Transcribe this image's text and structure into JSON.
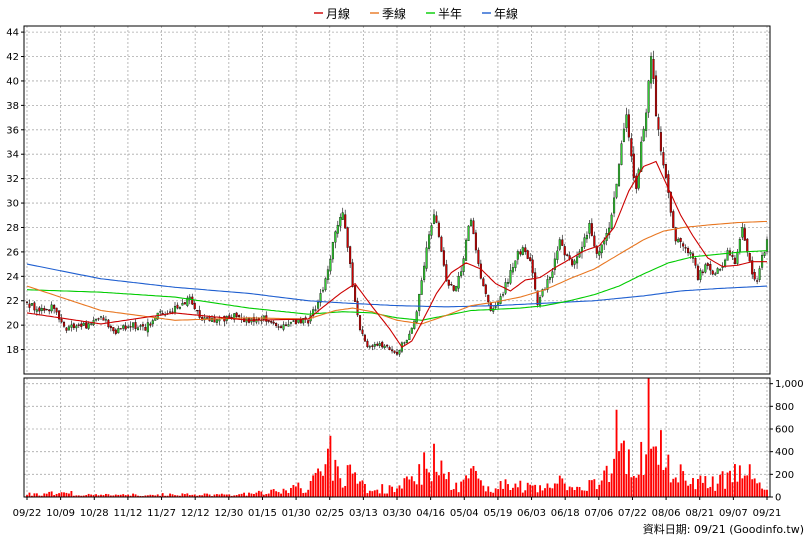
{
  "chart_data": [
    {
      "type": "candlestick",
      "legend": {
        "placement": "top-center",
        "items": [
          {
            "name": "月線",
            "color": "#cc0000"
          },
          {
            "name": "季線",
            "color": "#e87722"
          },
          {
            "name": "半年",
            "color": "#00cc00"
          },
          {
            "name": "年線",
            "color": "#1f5fd0"
          }
        ]
      },
      "ylim": [
        16,
        44.5
      ],
      "y_ticks": [
        18,
        20,
        22,
        24,
        26,
        28,
        30,
        32,
        34,
        36,
        38,
        40,
        42,
        44
      ],
      "x_tick_labels": [
        "09/22",
        "10/09",
        "10/28",
        "11/12",
        "11/27",
        "12/12",
        "12/30",
        "01/15",
        "01/30",
        "02/25",
        "03/13",
        "03/30",
        "04/16",
        "05/04",
        "05/19",
        "06/03",
        "06/18",
        "07/06",
        "07/22",
        "08/06",
        "08/21",
        "09/07",
        "09/21"
      ],
      "grid": true,
      "up_color": "#33cc33",
      "down_color": "#cc0000",
      "close_anchors": [
        [
          0,
          21.8
        ],
        [
          6,
          21.2
        ],
        [
          10,
          21.5
        ],
        [
          16,
          19.8
        ],
        [
          24,
          20.0
        ],
        [
          30,
          20.6
        ],
        [
          36,
          19.5
        ],
        [
          42,
          20.0
        ],
        [
          48,
          19.8
        ],
        [
          54,
          21.0
        ],
        [
          60,
          21.3
        ],
        [
          66,
          22.2
        ],
        [
          70,
          20.5
        ],
        [
          78,
          20.4
        ],
        [
          84,
          20.8
        ],
        [
          90,
          20.4
        ],
        [
          96,
          20.7
        ],
        [
          102,
          19.6
        ],
        [
          108,
          20.3
        ],
        [
          114,
          20.4
        ],
        [
          118,
          21.8
        ],
        [
          122,
          24.5
        ],
        [
          125,
          27.5
        ],
        [
          128,
          29.0
        ],
        [
          131,
          25.0
        ],
        [
          133,
          21.8
        ],
        [
          135,
          19.5
        ],
        [
          138,
          18.4
        ],
        [
          142,
          18.5
        ],
        [
          146,
          18.2
        ],
        [
          150,
          17.7
        ],
        [
          154,
          19.0
        ],
        [
          158,
          21.0
        ],
        [
          160,
          23.8
        ],
        [
          163,
          27.5
        ],
        [
          165,
          29.2
        ],
        [
          167,
          27.2
        ],
        [
          170,
          23.8
        ],
        [
          173,
          23.0
        ],
        [
          176,
          24.2
        ],
        [
          178,
          27.3
        ],
        [
          180,
          28.7
        ],
        [
          182,
          26.3
        ],
        [
          184,
          24.0
        ],
        [
          188,
          21.0
        ],
        [
          192,
          22.3
        ],
        [
          196,
          24.3
        ],
        [
          199,
          25.8
        ],
        [
          201,
          26.2
        ],
        [
          204,
          25.4
        ],
        [
          207,
          21.7
        ],
        [
          210,
          23.2
        ],
        [
          213,
          24.5
        ],
        [
          216,
          26.8
        ],
        [
          219,
          25.5
        ],
        [
          222,
          25.0
        ],
        [
          225,
          26.5
        ],
        [
          228,
          28.3
        ],
        [
          231,
          26.0
        ],
        [
          234,
          26.8
        ],
        [
          237,
          28.8
        ],
        [
          239,
          31.5
        ],
        [
          241,
          34.5
        ],
        [
          243,
          36.8
        ],
        [
          245,
          33.5
        ],
        [
          247,
          30.8
        ],
        [
          249,
          35.0
        ],
        [
          251,
          37.5
        ],
        [
          253,
          42.5
        ],
        [
          255,
          37.0
        ],
        [
          257,
          34.5
        ],
        [
          259,
          32.0
        ],
        [
          261,
          29.5
        ],
        [
          263,
          27.0
        ],
        [
          266,
          26.5
        ],
        [
          269,
          26.0
        ],
        [
          272,
          24.0
        ],
        [
          275,
          24.8
        ],
        [
          278,
          24.3
        ],
        [
          281,
          24.5
        ],
        [
          284,
          26.2
        ],
        [
          287,
          25.2
        ],
        [
          290,
          27.8
        ],
        [
          292,
          26.0
        ],
        [
          294,
          24.0
        ],
        [
          296,
          23.6
        ],
        [
          298,
          25.5
        ],
        [
          300,
          27.0
        ]
      ],
      "ma_month_anchors": [
        [
          0,
          21.0
        ],
        [
          30,
          20.1
        ],
        [
          60,
          21.0
        ],
        [
          90,
          20.4
        ],
        [
          114,
          20.5
        ],
        [
          122,
          21.8
        ],
        [
          127,
          22.6
        ],
        [
          133,
          23.4
        ],
        [
          140,
          21.5
        ],
        [
          147,
          19.7
        ],
        [
          152,
          18.2
        ],
        [
          156,
          18.7
        ],
        [
          160,
          20.2
        ],
        [
          166,
          22.6
        ],
        [
          172,
          24.3
        ],
        [
          178,
          25.1
        ],
        [
          184,
          24.6
        ],
        [
          190,
          23.4
        ],
        [
          196,
          22.8
        ],
        [
          202,
          23.7
        ],
        [
          208,
          23.9
        ],
        [
          214,
          24.7
        ],
        [
          220,
          25.4
        ],
        [
          226,
          26.1
        ],
        [
          232,
          26.5
        ],
        [
          238,
          28.0
        ],
        [
          244,
          31.0
        ],
        [
          250,
          33.0
        ],
        [
          255,
          33.4
        ],
        [
          260,
          31.2
        ],
        [
          265,
          29.0
        ],
        [
          270,
          27.3
        ],
        [
          276,
          25.5
        ],
        [
          282,
          24.8
        ],
        [
          288,
          24.9
        ],
        [
          294,
          25.2
        ],
        [
          300,
          25.2
        ]
      ],
      "ma_quarter_anchors": [
        [
          0,
          23.2
        ],
        [
          30,
          21.2
        ],
        [
          60,
          20.4
        ],
        [
          90,
          20.6
        ],
        [
          114,
          20.5
        ],
        [
          125,
          21.2
        ],
        [
          132,
          21.4
        ],
        [
          140,
          21.1
        ],
        [
          150,
          20.4
        ],
        [
          160,
          20.1
        ],
        [
          170,
          20.8
        ],
        [
          180,
          21.6
        ],
        [
          190,
          21.9
        ],
        [
          200,
          22.3
        ],
        [
          210,
          22.9
        ],
        [
          220,
          23.8
        ],
        [
          230,
          24.6
        ],
        [
          240,
          25.8
        ],
        [
          250,
          27.0
        ],
        [
          258,
          27.7
        ],
        [
          266,
          28.0
        ],
        [
          276,
          28.2
        ],
        [
          288,
          28.4
        ],
        [
          300,
          28.5
        ]
      ],
      "ma_half_anchors": [
        [
          0,
          22.9
        ],
        [
          30,
          22.7
        ],
        [
          60,
          22.3
        ],
        [
          90,
          21.4
        ],
        [
          114,
          20.9
        ],
        [
          128,
          21.1
        ],
        [
          140,
          21.0
        ],
        [
          150,
          20.6
        ],
        [
          160,
          20.4
        ],
        [
          170,
          20.8
        ],
        [
          180,
          21.2
        ],
        [
          190,
          21.3
        ],
        [
          200,
          21.4
        ],
        [
          210,
          21.6
        ],
        [
          220,
          22.0
        ],
        [
          230,
          22.5
        ],
        [
          240,
          23.2
        ],
        [
          250,
          24.2
        ],
        [
          260,
          25.1
        ],
        [
          270,
          25.6
        ],
        [
          280,
          25.8
        ],
        [
          290,
          26.0
        ],
        [
          300,
          26.1
        ]
      ],
      "ma_year_anchors": [
        [
          0,
          25.0
        ],
        [
          30,
          23.8
        ],
        [
          60,
          23.1
        ],
        [
          90,
          22.6
        ],
        [
          114,
          22.0
        ],
        [
          130,
          21.8
        ],
        [
          150,
          21.6
        ],
        [
          170,
          21.5
        ],
        [
          190,
          21.6
        ],
        [
          210,
          21.8
        ],
        [
          230,
          22.0
        ],
        [
          250,
          22.4
        ],
        [
          265,
          22.8
        ],
        [
          280,
          23.0
        ],
        [
          300,
          23.2
        ]
      ]
    },
    {
      "type": "bar",
      "ylim": [
        0,
        1050
      ],
      "y_tick_labels": [
        "0",
        "200",
        "400",
        "600",
        "800",
        "1,000"
      ],
      "y_ticks": [
        0,
        200,
        400,
        600,
        800,
        1000
      ],
      "bar_color": "#ff0000",
      "volume_anchors": [
        [
          0,
          30
        ],
        [
          8,
          25
        ],
        [
          14,
          70
        ],
        [
          20,
          20
        ],
        [
          40,
          20
        ],
        [
          60,
          25
        ],
        [
          80,
          20
        ],
        [
          96,
          40
        ],
        [
          104,
          60
        ],
        [
          110,
          90
        ],
        [
          114,
          70
        ],
        [
          118,
          260
        ],
        [
          121,
          350
        ],
        [
          124,
          250
        ],
        [
          127,
          220
        ],
        [
          130,
          220
        ],
        [
          135,
          110
        ],
        [
          140,
          90
        ],
        [
          146,
          85
        ],
        [
          152,
          120
        ],
        [
          158,
          210
        ],
        [
          161,
          300
        ],
        [
          164,
          370
        ],
        [
          167,
          260
        ],
        [
          170,
          170
        ],
        [
          175,
          120
        ],
        [
          180,
          250
        ],
        [
          184,
          170
        ],
        [
          188,
          80
        ],
        [
          195,
          120
        ],
        [
          200,
          110
        ],
        [
          206,
          90
        ],
        [
          212,
          150
        ],
        [
          218,
          130
        ],
        [
          224,
          110
        ],
        [
          230,
          130
        ],
        [
          236,
          260
        ],
        [
          240,
          510
        ],
        [
          243,
          380
        ],
        [
          246,
          270
        ],
        [
          250,
          400
        ],
        [
          253,
          730
        ],
        [
          256,
          450
        ],
        [
          259,
          320
        ],
        [
          262,
          270
        ],
        [
          266,
          210
        ],
        [
          270,
          160
        ],
        [
          276,
          130
        ],
        [
          282,
          160
        ],
        [
          288,
          220
        ],
        [
          294,
          260
        ],
        [
          300,
          90
        ]
      ],
      "volume_spikes": [
        [
          123,
          540
        ],
        [
          165,
          470
        ],
        [
          239,
          770
        ],
        [
          252,
          1060
        ],
        [
          257,
          590
        ]
      ]
    }
  ],
  "footer": {
    "date_label": "資料日期: 09/21 (Goodinfo.tw)"
  }
}
